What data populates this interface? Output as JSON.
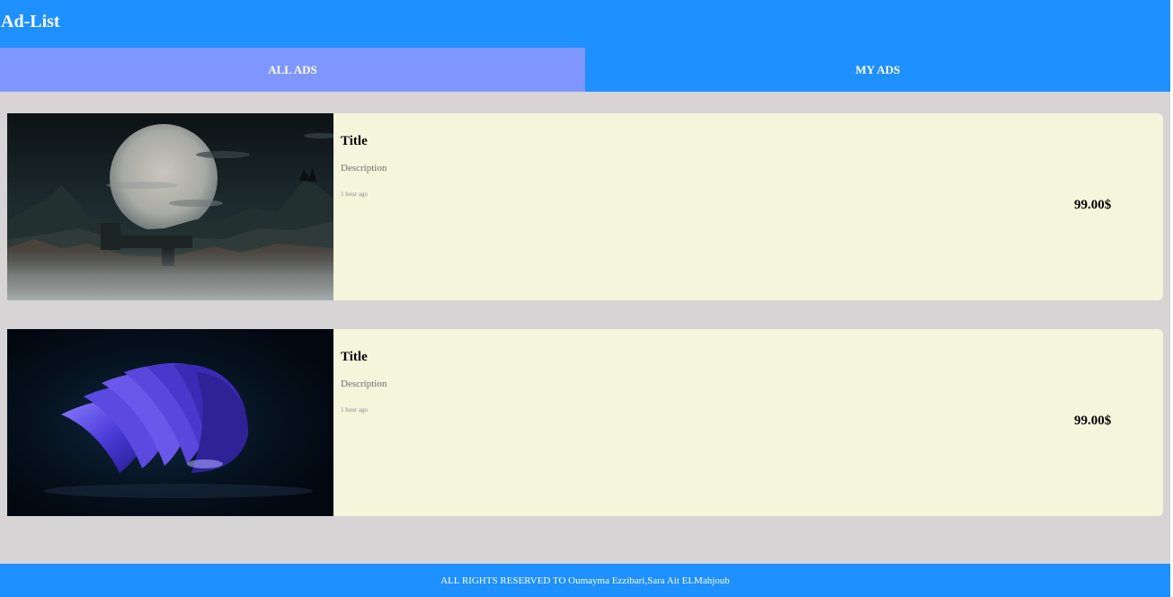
{
  "app": {
    "brand": "Ad-List"
  },
  "tabs": [
    {
      "label": "ALL ADS",
      "active": true
    },
    {
      "label": "MY ADS",
      "active": false
    }
  ],
  "ads": [
    {
      "title": "Title",
      "description": "Description",
      "posted": "1 hour ago",
      "price": "99.00$",
      "image": "night-landscape-moon-castle"
    },
    {
      "title": "Title",
      "description": "Description",
      "posted": "1 hour ago",
      "price": "99.00$",
      "image": "abstract-blue-purple-shell"
    }
  ],
  "footer": {
    "text": "ALL RIGHTS RESERVED TO Oumayma Ezzibari,Sara Ait ELMahjoub"
  },
  "colors": {
    "header": "#1e90ff",
    "active_tab": "#7f96ff",
    "card_bg": "#f5f5dc",
    "page_bg": "#d6d4d5"
  }
}
